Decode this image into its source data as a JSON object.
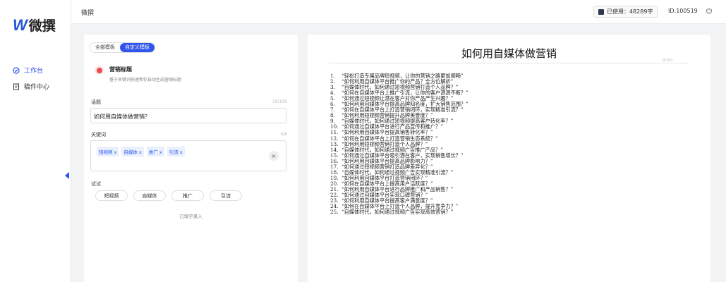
{
  "brand": {
    "mark": "W",
    "name": "微撰"
  },
  "nav": {
    "items": [
      {
        "label": "工作台",
        "icon": "workbench-icon",
        "active": true
      },
      {
        "label": "稿件中心",
        "icon": "document-icon",
        "active": false
      }
    ]
  },
  "header": {
    "breadcrumb": "微撰",
    "usage_label": "已使用：48289字",
    "user_id": "ID:100519",
    "logout_icon": "power-icon"
  },
  "editor": {
    "tabs": [
      {
        "label": "全部模板",
        "active": false
      },
      {
        "label": "自定义模板",
        "active": true
      }
    ],
    "template": {
      "title": "营销标题",
      "desc": "基于关键词快速帮你自动生成营销标题"
    },
    "topic": {
      "label": "话题",
      "count": "10/100",
      "value": "如何用自媒体做营销？"
    },
    "keywords": {
      "label": "关键词",
      "count": "4/8",
      "chips": [
        "短视频 x",
        "自媒体 x",
        "推广 x",
        "引流 x"
      ],
      "clear": "×"
    },
    "try": {
      "label": "试试",
      "options": [
        "短视频",
        "自媒体",
        "推广",
        "引流"
      ]
    },
    "more": "已填空录入"
  },
  "document": {
    "title": "如何用自媒体做营销",
    "count": "9/100",
    "lines": [
      "“轻松打造专属品牌短视频，让你的营销之路更加顺畅”",
      "“如何利用自媒体平台推广你的产品？全方位解析”",
      "“自媒体时代，如何通过短视频营销打造个人品牌？”",
      "“如何在自媒体平台上推广引流，让你的客户源源不断？”",
      "“如何通过短视频让潜在客户对你产品产生兴趣？”",
      "“如何利用自媒体平台提高品牌知名度，扩大销售范围？”",
      "“如何在自媒体平台上打造营销闭环，实现精准引流？”",
      "“如何利用短视频营销提升品牌美誉度？”",
      "“自媒体时代，如何通过短视频提高客户转化率？”",
      "“如何通过自媒体平台进行产品宣传和推广？”",
      "“如何利用自媒体平台提高销售转化率？”",
      "“如何在自媒体平台上打造营销生态系统？”",
      "“如何利用短视频营销打造个人品牌？”",
      "“自媒体时代，如何通过视频广告推广产品？”",
      "“如何通过自媒体平台吸引潜在客户，实现销售增长？”",
      "“如何利用自媒体平台提高品牌影响力？”",
      "“如何通过短视频营销打造品牌差异化？”",
      "“自媒体时代，如何通过视频广告实现精准引流？”",
      "“如何利用自媒体平台打造营销闭环？”",
      "“如何在自媒体平台上提高用户活跃度？”",
      "“如何利用自媒体平台进行品牌推广和产品销售？”",
      "“如何通过自媒体平台实现口碑营销？”",
      "“如何利用自媒体平台提高客户满意度？”",
      "“如何在自媒体平台上打造个人品牌，提升竞争力？”",
      "“自媒体时代，如何通过视频广告实现高效营销？”"
    ]
  }
}
